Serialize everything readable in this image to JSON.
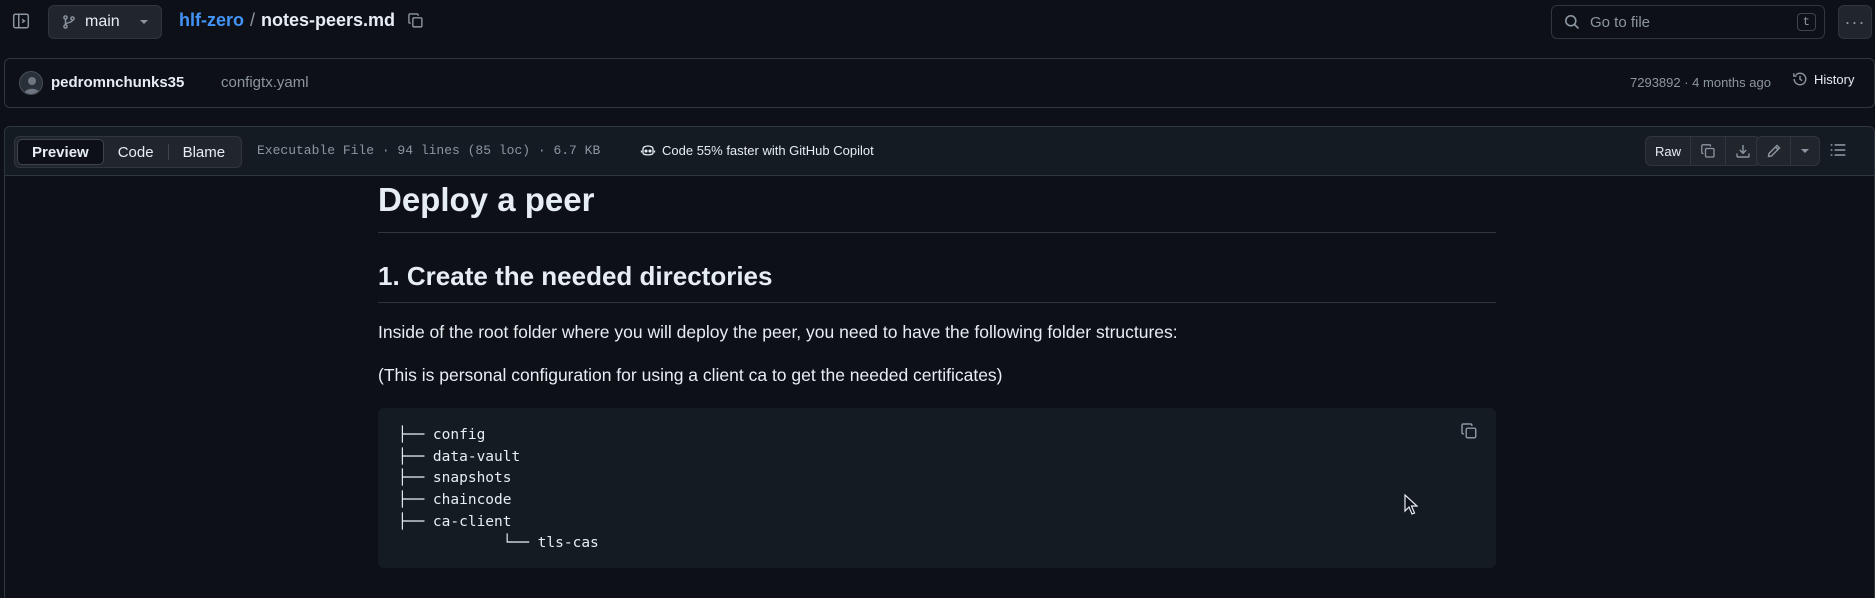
{
  "header": {
    "branch": "main",
    "repo": "hlf-zero",
    "separator": "/",
    "file": "notes-peers.md",
    "goto_placeholder": "Go to file",
    "goto_key": "t"
  },
  "commit": {
    "author": "pedromnchunks35",
    "message": "configtx.yaml",
    "meta": "7293892 · 4 months ago",
    "history_label": "History"
  },
  "file_header": {
    "tabs": [
      "Preview",
      "Code",
      "Blame"
    ],
    "info": "Executable File · 94 lines (85 loc) · 6.7 KB",
    "copilot": "Code 55% faster with GitHub Copilot",
    "raw_label": "Raw"
  },
  "content": {
    "h1": "Deploy a peer",
    "h2": "1. Create the needed directories",
    "p1": "Inside of the root folder where you will deploy the peer, you need to have the following folder structures:",
    "p2": "(This is personal configuration for using a client ca to get the needed certificates)",
    "code": "├── config\n├── data-vault\n├── snapshots\n├── chaincode\n├── ca-client\n            └── tls-cas"
  },
  "colors": {
    "background": "#0d1117",
    "link": "#4493f8",
    "muted": "#8d96a0",
    "border": "#30363d"
  }
}
